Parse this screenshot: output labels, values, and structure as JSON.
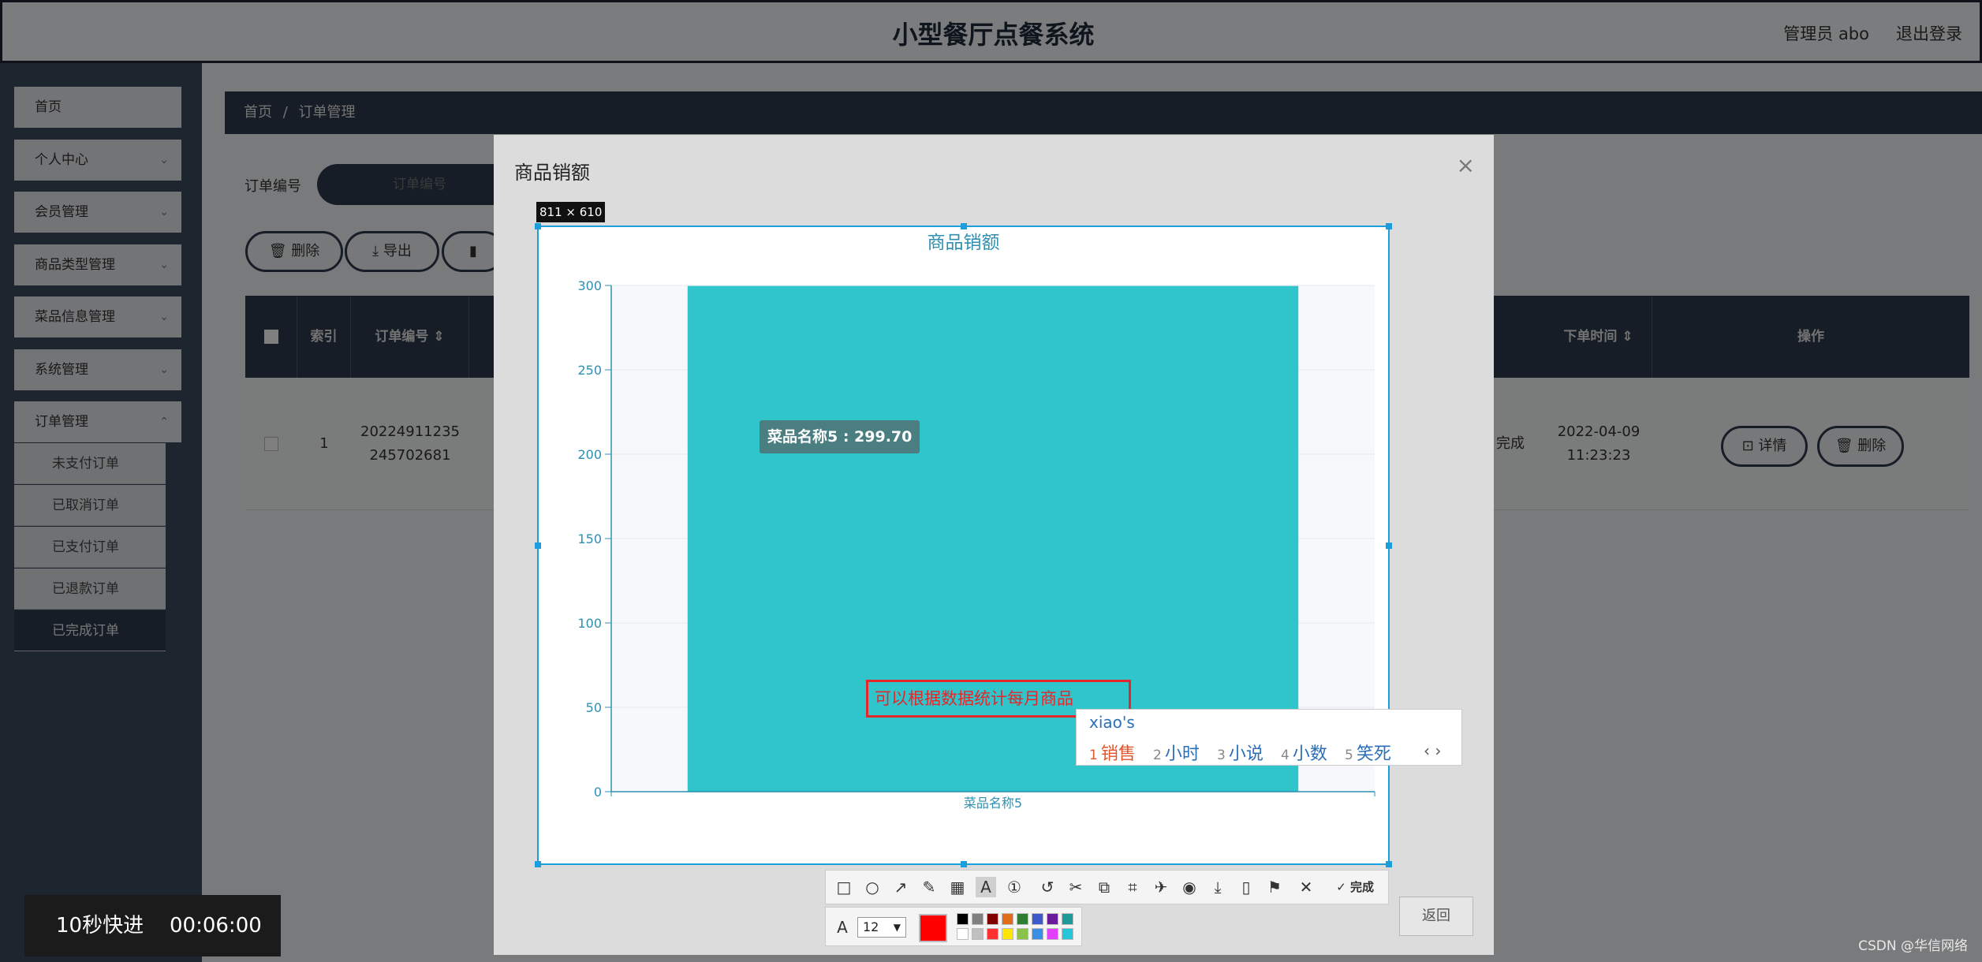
{
  "app": {
    "title": "小型餐厅点餐系统",
    "user_label": "管理员 abo",
    "logout_label": "退出登录"
  },
  "sidebar": {
    "items": [
      {
        "label": "首页"
      },
      {
        "label": "个人中心"
      },
      {
        "label": "会员管理"
      },
      {
        "label": "商品类型管理"
      },
      {
        "label": "菜品信息管理"
      },
      {
        "label": "系统管理"
      },
      {
        "label": "订单管理"
      }
    ],
    "order_subitems": [
      {
        "label": "未支付订单"
      },
      {
        "label": "已取消订单"
      },
      {
        "label": "已支付订单"
      },
      {
        "label": "已退款订单"
      },
      {
        "label": "已完成订单"
      }
    ]
  },
  "breadcrumb": {
    "home": "首页",
    "sep": "/",
    "current": "订单管理"
  },
  "filter": {
    "label": "订单编号",
    "placeholder": "订单编号"
  },
  "toolbar": {
    "delete_label": "删除",
    "export_label": "导出"
  },
  "table": {
    "headers": [
      "索引",
      "订单编号",
      "下单时间",
      "操作"
    ],
    "row": {
      "index": "1",
      "order_no": "20224911235245702681",
      "status_partial": "完成",
      "order_time": "2022-04-09 11:23:23",
      "detail_label": "详情",
      "delete_label": "删除"
    }
  },
  "dialog": {
    "title": "商品销额",
    "close": "×",
    "back_label": "返回"
  },
  "screenshot": {
    "size_label": "811 × 610"
  },
  "chart_data": {
    "type": "bar",
    "title": "商品销额",
    "categories": [
      "菜品名称5"
    ],
    "values": [
      299.7
    ],
    "ylim": [
      0,
      300
    ],
    "yticks": [
      0,
      50,
      100,
      150,
      200,
      250,
      300
    ],
    "grid": true,
    "tooltip": "菜品名称5 : 299.70",
    "bar_color": "#30c5ca",
    "axis_color": "#2e8fb0"
  },
  "annotation": {
    "text": "可以根据数据统计每月商品"
  },
  "ime": {
    "composition": "xiao's",
    "candidates": [
      {
        "n": "1",
        "text": "销售"
      },
      {
        "n": "2",
        "text": "小时"
      },
      {
        "n": "3",
        "text": "小说"
      },
      {
        "n": "4",
        "text": "小数"
      },
      {
        "n": "5",
        "text": "笑死"
      }
    ],
    "arrows": "‹ ›"
  },
  "annot_toolbar": {
    "done_label": "完成",
    "font_size": "12",
    "current_color": "#ff0000",
    "palette": [
      "#000000",
      "#808080",
      "#800000",
      "#e06c1c",
      "#2e7d32",
      "#3b5bcc",
      "#6a1b9a",
      "#1e9a9a",
      "#ffffff",
      "#c0c0c0",
      "#ff3030",
      "#ffe600",
      "#8bc34a",
      "#3a8ee6",
      "#e040fb",
      "#26c6da"
    ]
  },
  "video": {
    "ff_label": "10秒快进",
    "time": "00:06:00"
  },
  "watermark": "CSDN @华信网络"
}
